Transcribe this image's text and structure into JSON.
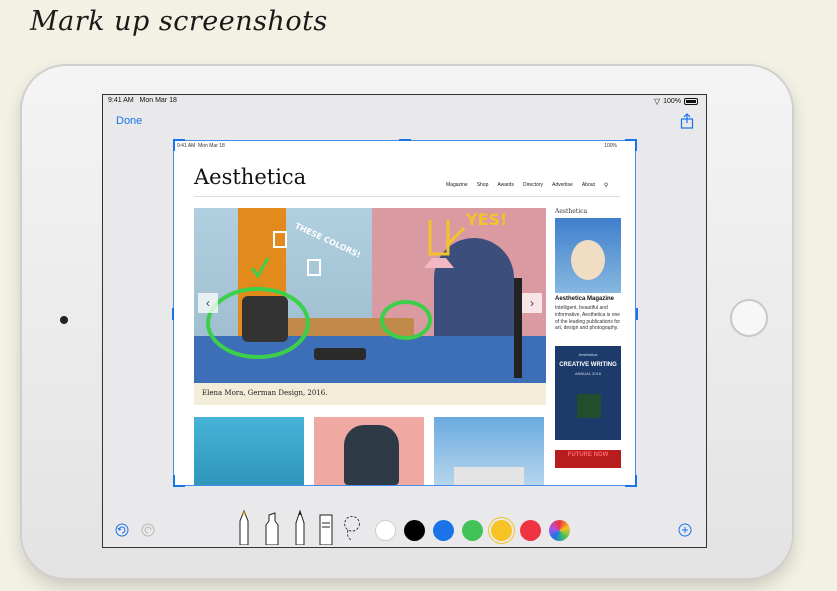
{
  "headline": "Mark up screenshots",
  "device_status": {
    "time": "9:41 AM",
    "date": "Mon Mar 18",
    "battery": "100%"
  },
  "nav_bar": {
    "done_label": "Done"
  },
  "inner_status": {
    "time": "9:41 AM",
    "date": "Mon Mar 18",
    "battery": "100%"
  },
  "website": {
    "brand": "Aesthetica",
    "nav": [
      "Magazine",
      "Shop",
      "Awards",
      "Directory",
      "Advertise",
      "About"
    ],
    "hero": {
      "caption": "Elena Mora, German Design, 2016.",
      "annotation_these_colors": "THESE COLORS!",
      "annotation_yes": "YES!"
    },
    "sidebar": {
      "cover_title": "Aesthetica",
      "name": "Aesthetica Magazine",
      "description": "Intelligent, beautiful and informative, Aesthetica is one of the leading publications for art, design and photography.",
      "book_publisher": "Aesthetica",
      "book_title": "CREATIVE WRITING",
      "book_subtitle": "ANNUAL 2016",
      "book2_title": "FUTURE NOW"
    }
  },
  "toolbar": {
    "colors": [
      "#ffffff",
      "#000000",
      "#1a73e8",
      "#41c35a",
      "#f5c324",
      "#ee3342"
    ],
    "tools": [
      "pen",
      "marker",
      "pencil",
      "eraser",
      "lasso"
    ]
  }
}
